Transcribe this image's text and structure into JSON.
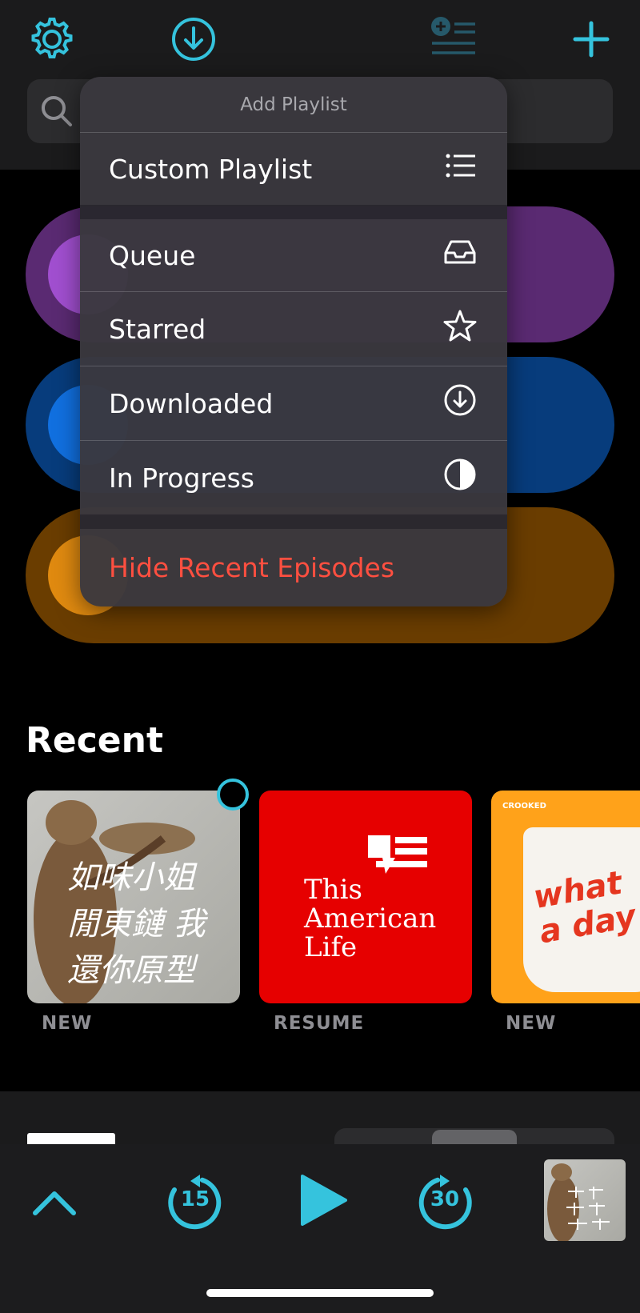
{
  "menu": {
    "title": "Add Playlist",
    "items": [
      {
        "label": "Custom Playlist",
        "icon": "list-icon"
      },
      {
        "label": "Queue",
        "icon": "inbox-tray-icon"
      },
      {
        "label": "Starred",
        "icon": "star-icon"
      },
      {
        "label": "Downloaded",
        "icon": "download-circle-icon"
      },
      {
        "label": "In Progress",
        "icon": "half-circle-icon"
      },
      {
        "label": "Hide Recent Episodes",
        "icon": ""
      }
    ]
  },
  "recent": {
    "title": "Recent",
    "items": [
      {
        "status": "NEW",
        "art_text": "如味小姐 閒東鏈 我還你原型"
      },
      {
        "status": "RESUME",
        "art_text": "This American Life"
      },
      {
        "status": "NEW",
        "art_brand": "CROOKED",
        "art_text": "what a day"
      }
    ]
  },
  "player": {
    "skip_back": "15",
    "skip_forward": "30"
  },
  "colors": {
    "accent": "#35c3dd",
    "danger": "#ff4f40",
    "purple_pill": "#5a2a72",
    "blue_pill": "#073c7c",
    "orange_pill": "#6a3d00"
  }
}
